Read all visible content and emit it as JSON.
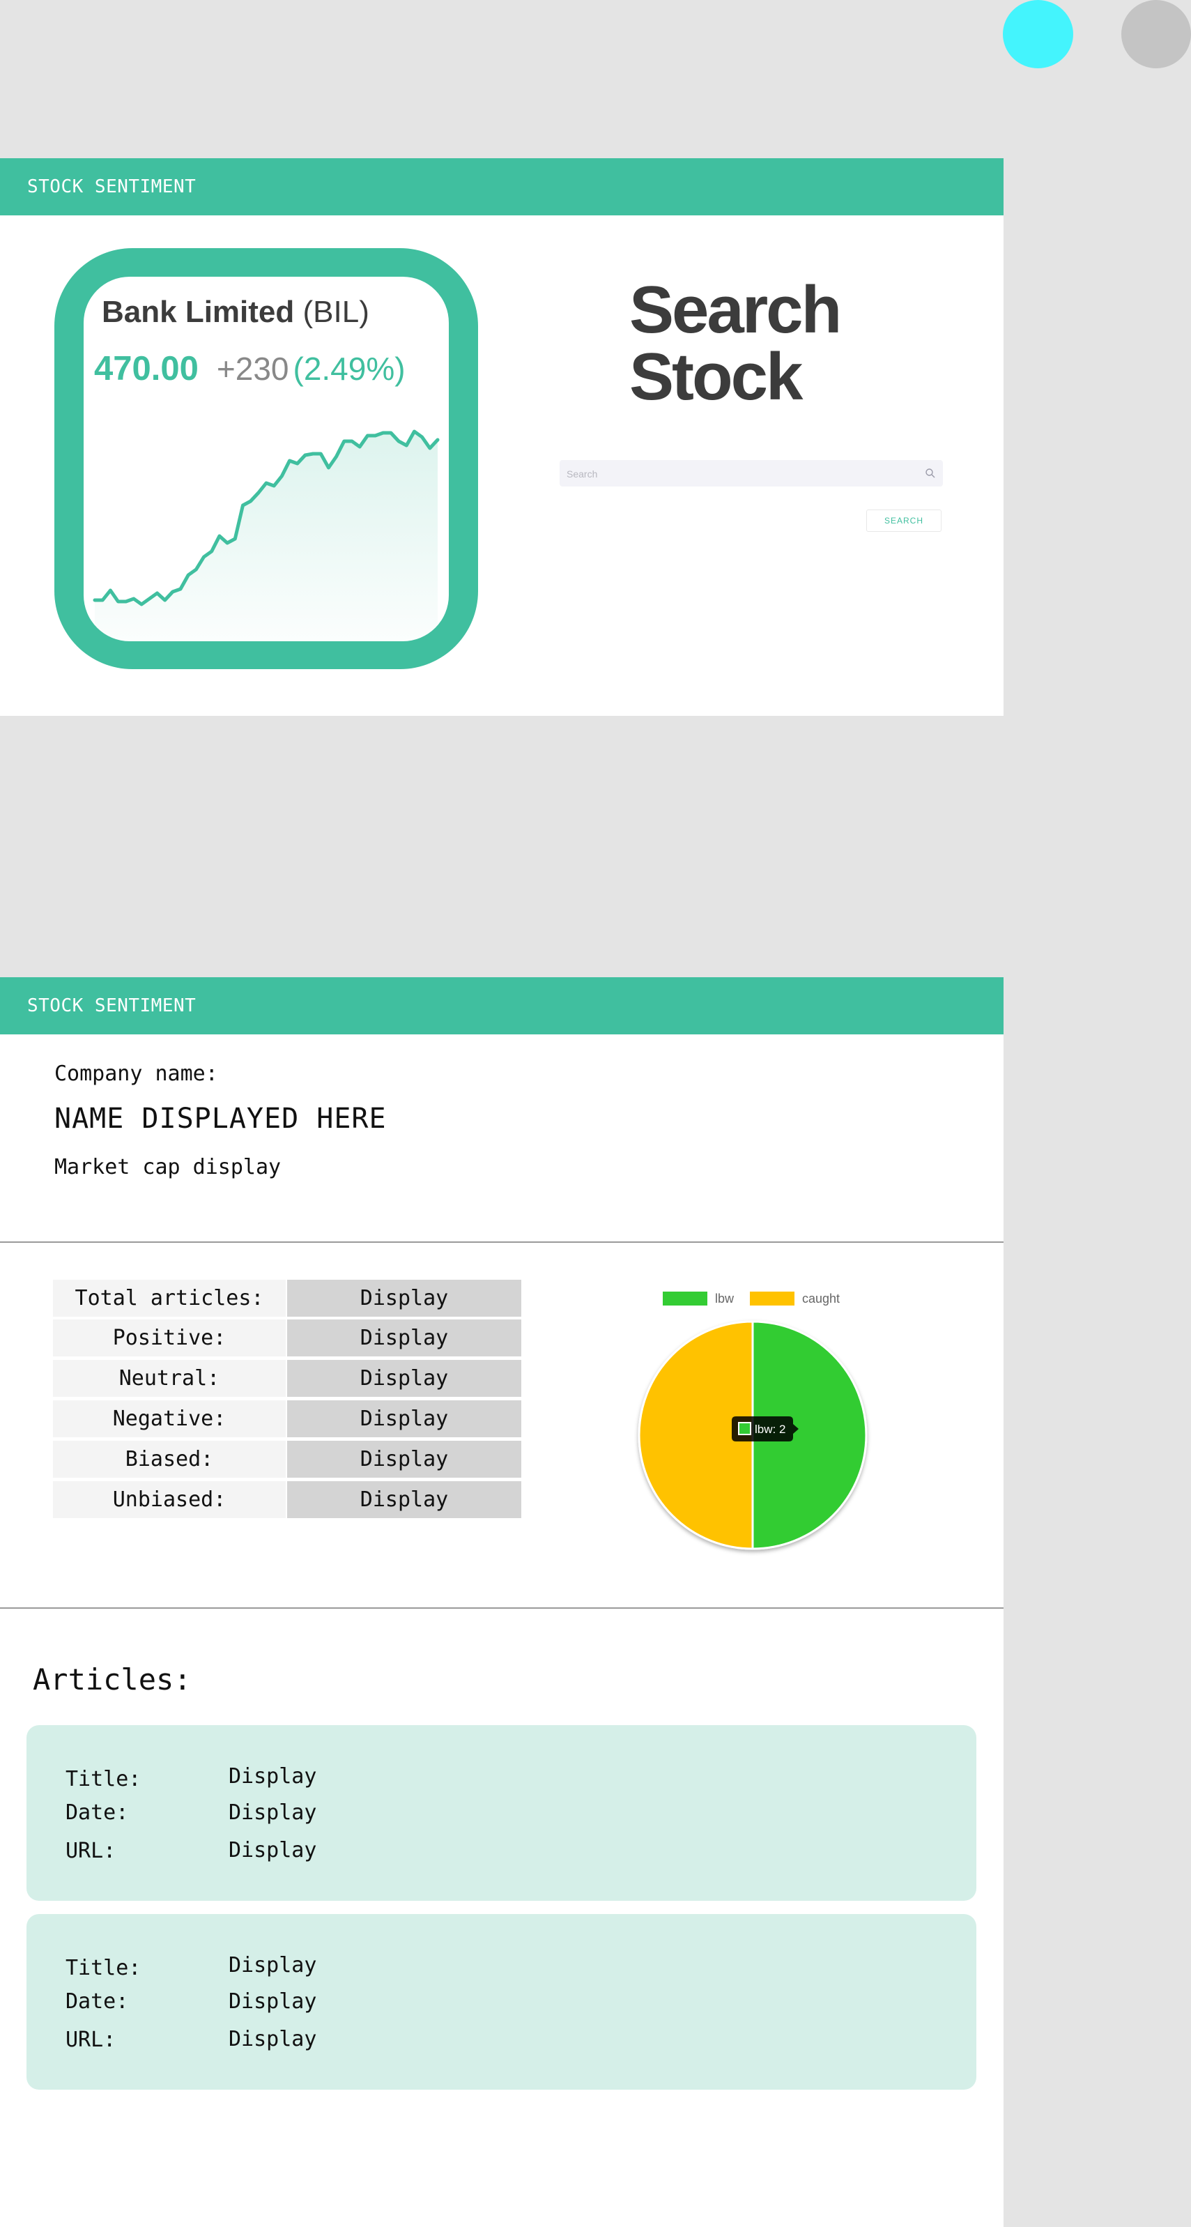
{
  "screen_1": {
    "brand": "STOCK SENTIMENT",
    "stock_card": {
      "company_name": "Bank Limited",
      "ticker": "(BIL)",
      "price": "470.00",
      "change": "+230",
      "change_pct": "(2.49%)"
    },
    "search": {
      "title_line1": "Search",
      "title_line2": "Stock",
      "placeholder": "Search",
      "button_label": "SEARCH"
    }
  },
  "screen_2": {
    "brand": "STOCK SENTIMENT",
    "company": {
      "label": "Company name:",
      "name": "NAME DISPLAYED HERE",
      "market_cap": "Market cap display"
    },
    "stats": [
      {
        "label": "Total articles:",
        "value": "Display"
      },
      {
        "label": "Positive:",
        "value": "Display"
      },
      {
        "label": "Neutral:",
        "value": "Display"
      },
      {
        "label": "Negative:",
        "value": "Display"
      },
      {
        "label": "Biased:",
        "value": "Display"
      },
      {
        "label": "Unbiased:",
        "value": "Display"
      }
    ],
    "articles_heading": "Articles:",
    "articles": [
      {
        "title_label": "Title:",
        "title": "Display",
        "date_label": "Date:",
        "date": "Display",
        "url_label": "URL:",
        "url": "Display"
      },
      {
        "title_label": "Title:",
        "title": "Display",
        "date_label": "Date:",
        "date": "Display",
        "url_label": "URL:",
        "url": "Display"
      }
    ]
  },
  "colors": {
    "accent": "#40bf9f",
    "dark_text": "#3c3c3c",
    "lbw": "#33cc33",
    "caught": "#ffc200",
    "cyan_circle": "#44f4fd",
    "gray_circle": "#c4c4c4"
  },
  "chart_data": [
    {
      "type": "line",
      "title": "",
      "x": [
        1,
        2,
        3,
        4,
        5,
        6,
        7,
        8,
        9,
        10,
        11,
        12,
        13,
        14,
        15,
        16,
        17,
        18,
        19,
        20,
        21,
        22,
        23,
        24,
        25,
        26,
        27,
        28,
        29,
        30,
        31,
        32,
        33,
        34,
        35,
        36,
        37,
        38,
        39,
        40,
        41,
        42,
        43,
        44,
        45
      ],
      "values": [
        8,
        8,
        15,
        7,
        7,
        9,
        5,
        9,
        13,
        8,
        14,
        16,
        26,
        30,
        39,
        43,
        54,
        49,
        52,
        76,
        79,
        85,
        92,
        90,
        97,
        108,
        106,
        112,
        113,
        113,
        103,
        111,
        122,
        122,
        118,
        126,
        126,
        128,
        128,
        122,
        119,
        129,
        125,
        117,
        123
      ],
      "grid": false,
      "legend": "none"
    },
    {
      "type": "pie",
      "labels": [
        "lbw",
        "caught"
      ],
      "values": [
        2,
        2
      ],
      "colors": [
        "#33cc33",
        "#ffc200"
      ],
      "legend": "top",
      "tooltip": "lbw: 2"
    }
  ]
}
